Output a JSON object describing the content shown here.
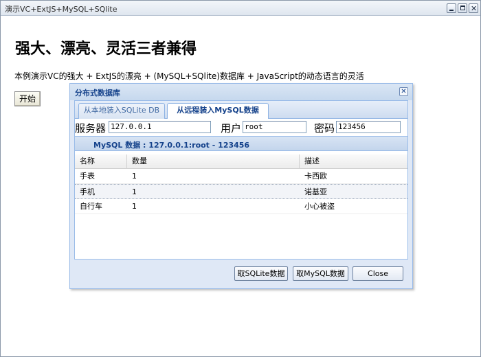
{
  "window": {
    "title": "演示VC+ExtJS+MySQL+SQlite",
    "minimize_icon": "minimize-icon",
    "maximize_icon": "maximize-icon",
    "close_icon": "close-icon"
  },
  "page": {
    "headline": "强大、漂亮、灵活三者兼得",
    "description": "本例演示VC的强大  + ExtJS的漂亮  + (MySQL+SQlite)数据库  + JavaScript的动态语言的灵活",
    "start_button": "开始"
  },
  "dialog": {
    "title": "分布式数据库",
    "close_icon": "close-icon",
    "tabs": [
      {
        "label": "从本地装入SQLite DB",
        "active": false
      },
      {
        "label": "从远程装入MySQL数据",
        "active": true
      }
    ],
    "form": {
      "server_label": "服务器",
      "server_value": "127.0.0.1",
      "user_label": "用户",
      "user_value": "root",
      "password_label": "密码",
      "password_value": "123456"
    },
    "panel_title": "MySQL 数据 : 127.0.0.1:root - 123456",
    "grid": {
      "columns": [
        "名称",
        "数量",
        "描述"
      ],
      "rows": [
        [
          "手表",
          "1",
          "卡西欧"
        ],
        [
          "手机",
          "1",
          "诺基亚"
        ],
        [
          "自行车",
          "1",
          "小心被盗"
        ]
      ]
    },
    "buttons": {
      "fetch_sqlite": "取SQLite数据",
      "fetch_mysql": "取MySQL数据",
      "close": "Close"
    }
  }
}
